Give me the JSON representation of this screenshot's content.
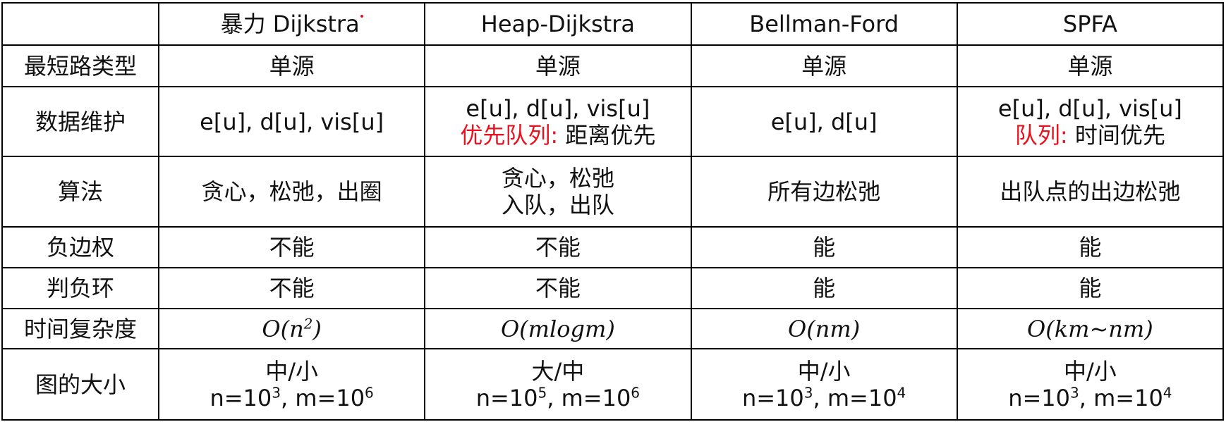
{
  "header": [
    "",
    "暴力 Dijkstra",
    "Heap-Dijkstra",
    "Bellman-Ford",
    "SPFA"
  ],
  "rows": {
    "type": {
      "label": "最短路类型",
      "cells": [
        "单源",
        "单源",
        "单源",
        "单源"
      ]
    },
    "data": {
      "label": "数据维护",
      "c1": "e[u], d[u], vis[u]",
      "c2_line1": "e[u], d[u], vis[u]",
      "c2_red": "优先队列:",
      "c2_rest": "距离优先",
      "c3": "e[u], d[u]",
      "c4_line1": "e[u], d[u], vis[u]",
      "c4_red": "队列:",
      "c4_rest": "时间优先"
    },
    "algo": {
      "label": "算法",
      "c1": "贪心，松弛，出圈",
      "c2_line1": "贪心，松弛",
      "c2_line2": "入队，出队",
      "c3": "所有边松弛",
      "c4": "出队点的出边松弛"
    },
    "negative_edge": {
      "label": "负边权",
      "cells": [
        "不能",
        "不能",
        "能",
        "能"
      ]
    },
    "negative_cycle": {
      "label": "判负环",
      "cells": [
        "不能",
        "不能",
        "能",
        "能"
      ]
    },
    "complexity": {
      "label": "时间复杂度",
      "c1_base": "O(n",
      "c1_exp": "2",
      "c1_close": ")",
      "c2": "O(mlogm)",
      "c3": "O(nm)",
      "c4": "O(km~nm)"
    },
    "size": {
      "label": "图的大小",
      "cells": [
        {
          "line1": "中/小",
          "n_base": "n=10",
          "n_exp": "3",
          "m_base": ", m=10",
          "m_exp": "6"
        },
        {
          "line1": "大/中",
          "n_base": "n=10",
          "n_exp": "5",
          "m_base": ", m=10",
          "m_exp": "6"
        },
        {
          "line1": "中/小",
          "n_base": "n=10",
          "n_exp": "3",
          "m_base": ", m=10",
          "m_exp": "4"
        },
        {
          "line1": "中/小",
          "n_base": "n=10",
          "n_exp": "3",
          "m_base": ", m=10",
          "m_exp": "4"
        }
      ]
    }
  },
  "colors": {
    "highlight": "#e8121f",
    "border": "#000000"
  }
}
